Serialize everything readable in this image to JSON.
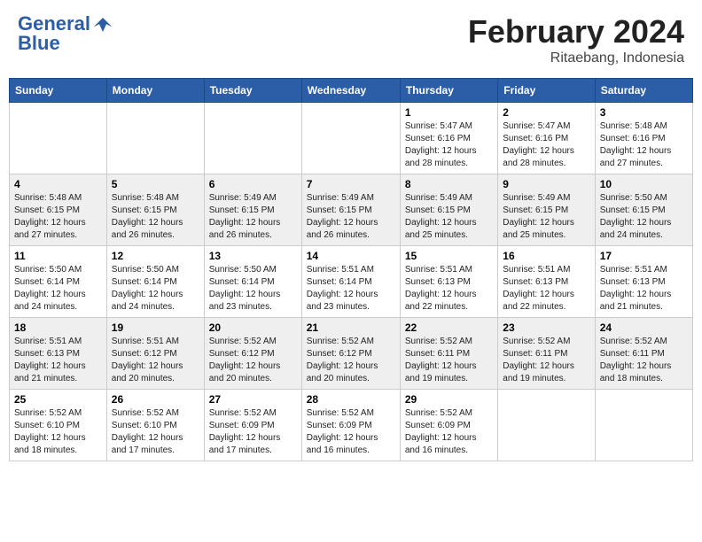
{
  "header": {
    "logo_line1": "General",
    "logo_line2": "Blue",
    "month": "February 2024",
    "location": "Ritaebang, Indonesia"
  },
  "weekdays": [
    "Sunday",
    "Monday",
    "Tuesday",
    "Wednesday",
    "Thursday",
    "Friday",
    "Saturday"
  ],
  "weeks": [
    [
      {
        "day": "",
        "info": ""
      },
      {
        "day": "",
        "info": ""
      },
      {
        "day": "",
        "info": ""
      },
      {
        "day": "",
        "info": ""
      },
      {
        "day": "1",
        "info": "Sunrise: 5:47 AM\nSunset: 6:16 PM\nDaylight: 12 hours\nand 28 minutes."
      },
      {
        "day": "2",
        "info": "Sunrise: 5:47 AM\nSunset: 6:16 PM\nDaylight: 12 hours\nand 28 minutes."
      },
      {
        "day": "3",
        "info": "Sunrise: 5:48 AM\nSunset: 6:16 PM\nDaylight: 12 hours\nand 27 minutes."
      }
    ],
    [
      {
        "day": "4",
        "info": "Sunrise: 5:48 AM\nSunset: 6:15 PM\nDaylight: 12 hours\nand 27 minutes."
      },
      {
        "day": "5",
        "info": "Sunrise: 5:48 AM\nSunset: 6:15 PM\nDaylight: 12 hours\nand 26 minutes."
      },
      {
        "day": "6",
        "info": "Sunrise: 5:49 AM\nSunset: 6:15 PM\nDaylight: 12 hours\nand 26 minutes."
      },
      {
        "day": "7",
        "info": "Sunrise: 5:49 AM\nSunset: 6:15 PM\nDaylight: 12 hours\nand 26 minutes."
      },
      {
        "day": "8",
        "info": "Sunrise: 5:49 AM\nSunset: 6:15 PM\nDaylight: 12 hours\nand 25 minutes."
      },
      {
        "day": "9",
        "info": "Sunrise: 5:49 AM\nSunset: 6:15 PM\nDaylight: 12 hours\nand 25 minutes."
      },
      {
        "day": "10",
        "info": "Sunrise: 5:50 AM\nSunset: 6:15 PM\nDaylight: 12 hours\nand 24 minutes."
      }
    ],
    [
      {
        "day": "11",
        "info": "Sunrise: 5:50 AM\nSunset: 6:14 PM\nDaylight: 12 hours\nand 24 minutes."
      },
      {
        "day": "12",
        "info": "Sunrise: 5:50 AM\nSunset: 6:14 PM\nDaylight: 12 hours\nand 24 minutes."
      },
      {
        "day": "13",
        "info": "Sunrise: 5:50 AM\nSunset: 6:14 PM\nDaylight: 12 hours\nand 23 minutes."
      },
      {
        "day": "14",
        "info": "Sunrise: 5:51 AM\nSunset: 6:14 PM\nDaylight: 12 hours\nand 23 minutes."
      },
      {
        "day": "15",
        "info": "Sunrise: 5:51 AM\nSunset: 6:13 PM\nDaylight: 12 hours\nand 22 minutes."
      },
      {
        "day": "16",
        "info": "Sunrise: 5:51 AM\nSunset: 6:13 PM\nDaylight: 12 hours\nand 22 minutes."
      },
      {
        "day": "17",
        "info": "Sunrise: 5:51 AM\nSunset: 6:13 PM\nDaylight: 12 hours\nand 21 minutes."
      }
    ],
    [
      {
        "day": "18",
        "info": "Sunrise: 5:51 AM\nSunset: 6:13 PM\nDaylight: 12 hours\nand 21 minutes."
      },
      {
        "day": "19",
        "info": "Sunrise: 5:51 AM\nSunset: 6:12 PM\nDaylight: 12 hours\nand 20 minutes."
      },
      {
        "day": "20",
        "info": "Sunrise: 5:52 AM\nSunset: 6:12 PM\nDaylight: 12 hours\nand 20 minutes."
      },
      {
        "day": "21",
        "info": "Sunrise: 5:52 AM\nSunset: 6:12 PM\nDaylight: 12 hours\nand 20 minutes."
      },
      {
        "day": "22",
        "info": "Sunrise: 5:52 AM\nSunset: 6:11 PM\nDaylight: 12 hours\nand 19 minutes."
      },
      {
        "day": "23",
        "info": "Sunrise: 5:52 AM\nSunset: 6:11 PM\nDaylight: 12 hours\nand 19 minutes."
      },
      {
        "day": "24",
        "info": "Sunrise: 5:52 AM\nSunset: 6:11 PM\nDaylight: 12 hours\nand 18 minutes."
      }
    ],
    [
      {
        "day": "25",
        "info": "Sunrise: 5:52 AM\nSunset: 6:10 PM\nDaylight: 12 hours\nand 18 minutes."
      },
      {
        "day": "26",
        "info": "Sunrise: 5:52 AM\nSunset: 6:10 PM\nDaylight: 12 hours\nand 17 minutes."
      },
      {
        "day": "27",
        "info": "Sunrise: 5:52 AM\nSunset: 6:09 PM\nDaylight: 12 hours\nand 17 minutes."
      },
      {
        "day": "28",
        "info": "Sunrise: 5:52 AM\nSunset: 6:09 PM\nDaylight: 12 hours\nand 16 minutes."
      },
      {
        "day": "29",
        "info": "Sunrise: 5:52 AM\nSunset: 6:09 PM\nDaylight: 12 hours\nand 16 minutes."
      },
      {
        "day": "",
        "info": ""
      },
      {
        "day": "",
        "info": ""
      }
    ]
  ]
}
